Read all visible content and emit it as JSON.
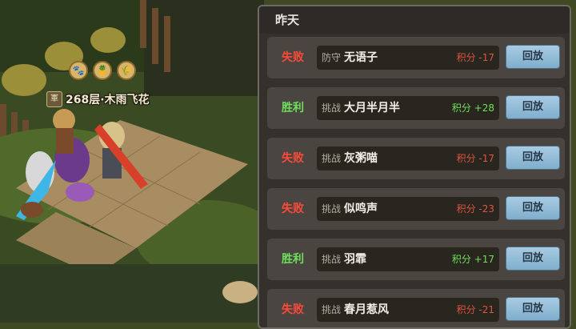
{
  "player": {
    "banner": "268层·木雨飞花",
    "rank_icon": "軍"
  },
  "status_icons": [
    {
      "icon": "paw-icon",
      "glyph": "🐾"
    },
    {
      "icon": "pineapple-icon",
      "glyph": "🍍"
    },
    {
      "icon": "wheat-icon",
      "glyph": "🌾"
    }
  ],
  "log": {
    "header": "昨天",
    "replay_label": "回放",
    "rows": [
      {
        "result": "失败",
        "outcome": "lose",
        "mode": "防守",
        "opponent": "无语子",
        "score": "积分 -17"
      },
      {
        "result": "胜利",
        "outcome": "win",
        "mode": "挑战",
        "opponent": "大月半月半",
        "score": "积分 +28"
      },
      {
        "result": "失败",
        "outcome": "lose",
        "mode": "挑战",
        "opponent": "灰粥喵",
        "score": "积分 -17"
      },
      {
        "result": "失败",
        "outcome": "lose",
        "mode": "挑战",
        "opponent": "似鸣声",
        "score": "积分 -23"
      },
      {
        "result": "胜利",
        "outcome": "win",
        "mode": "挑战",
        "opponent": "羽霏",
        "score": "积分 +17"
      },
      {
        "result": "失败",
        "outcome": "lose",
        "mode": "挑战",
        "opponent": "春月惹风",
        "score": "积分 -21"
      }
    ]
  },
  "colors": {
    "lose": "#ff4a3a",
    "win": "#6fe05a",
    "panel_bg": "#34302c",
    "replay_button": "#8fbcd8"
  }
}
